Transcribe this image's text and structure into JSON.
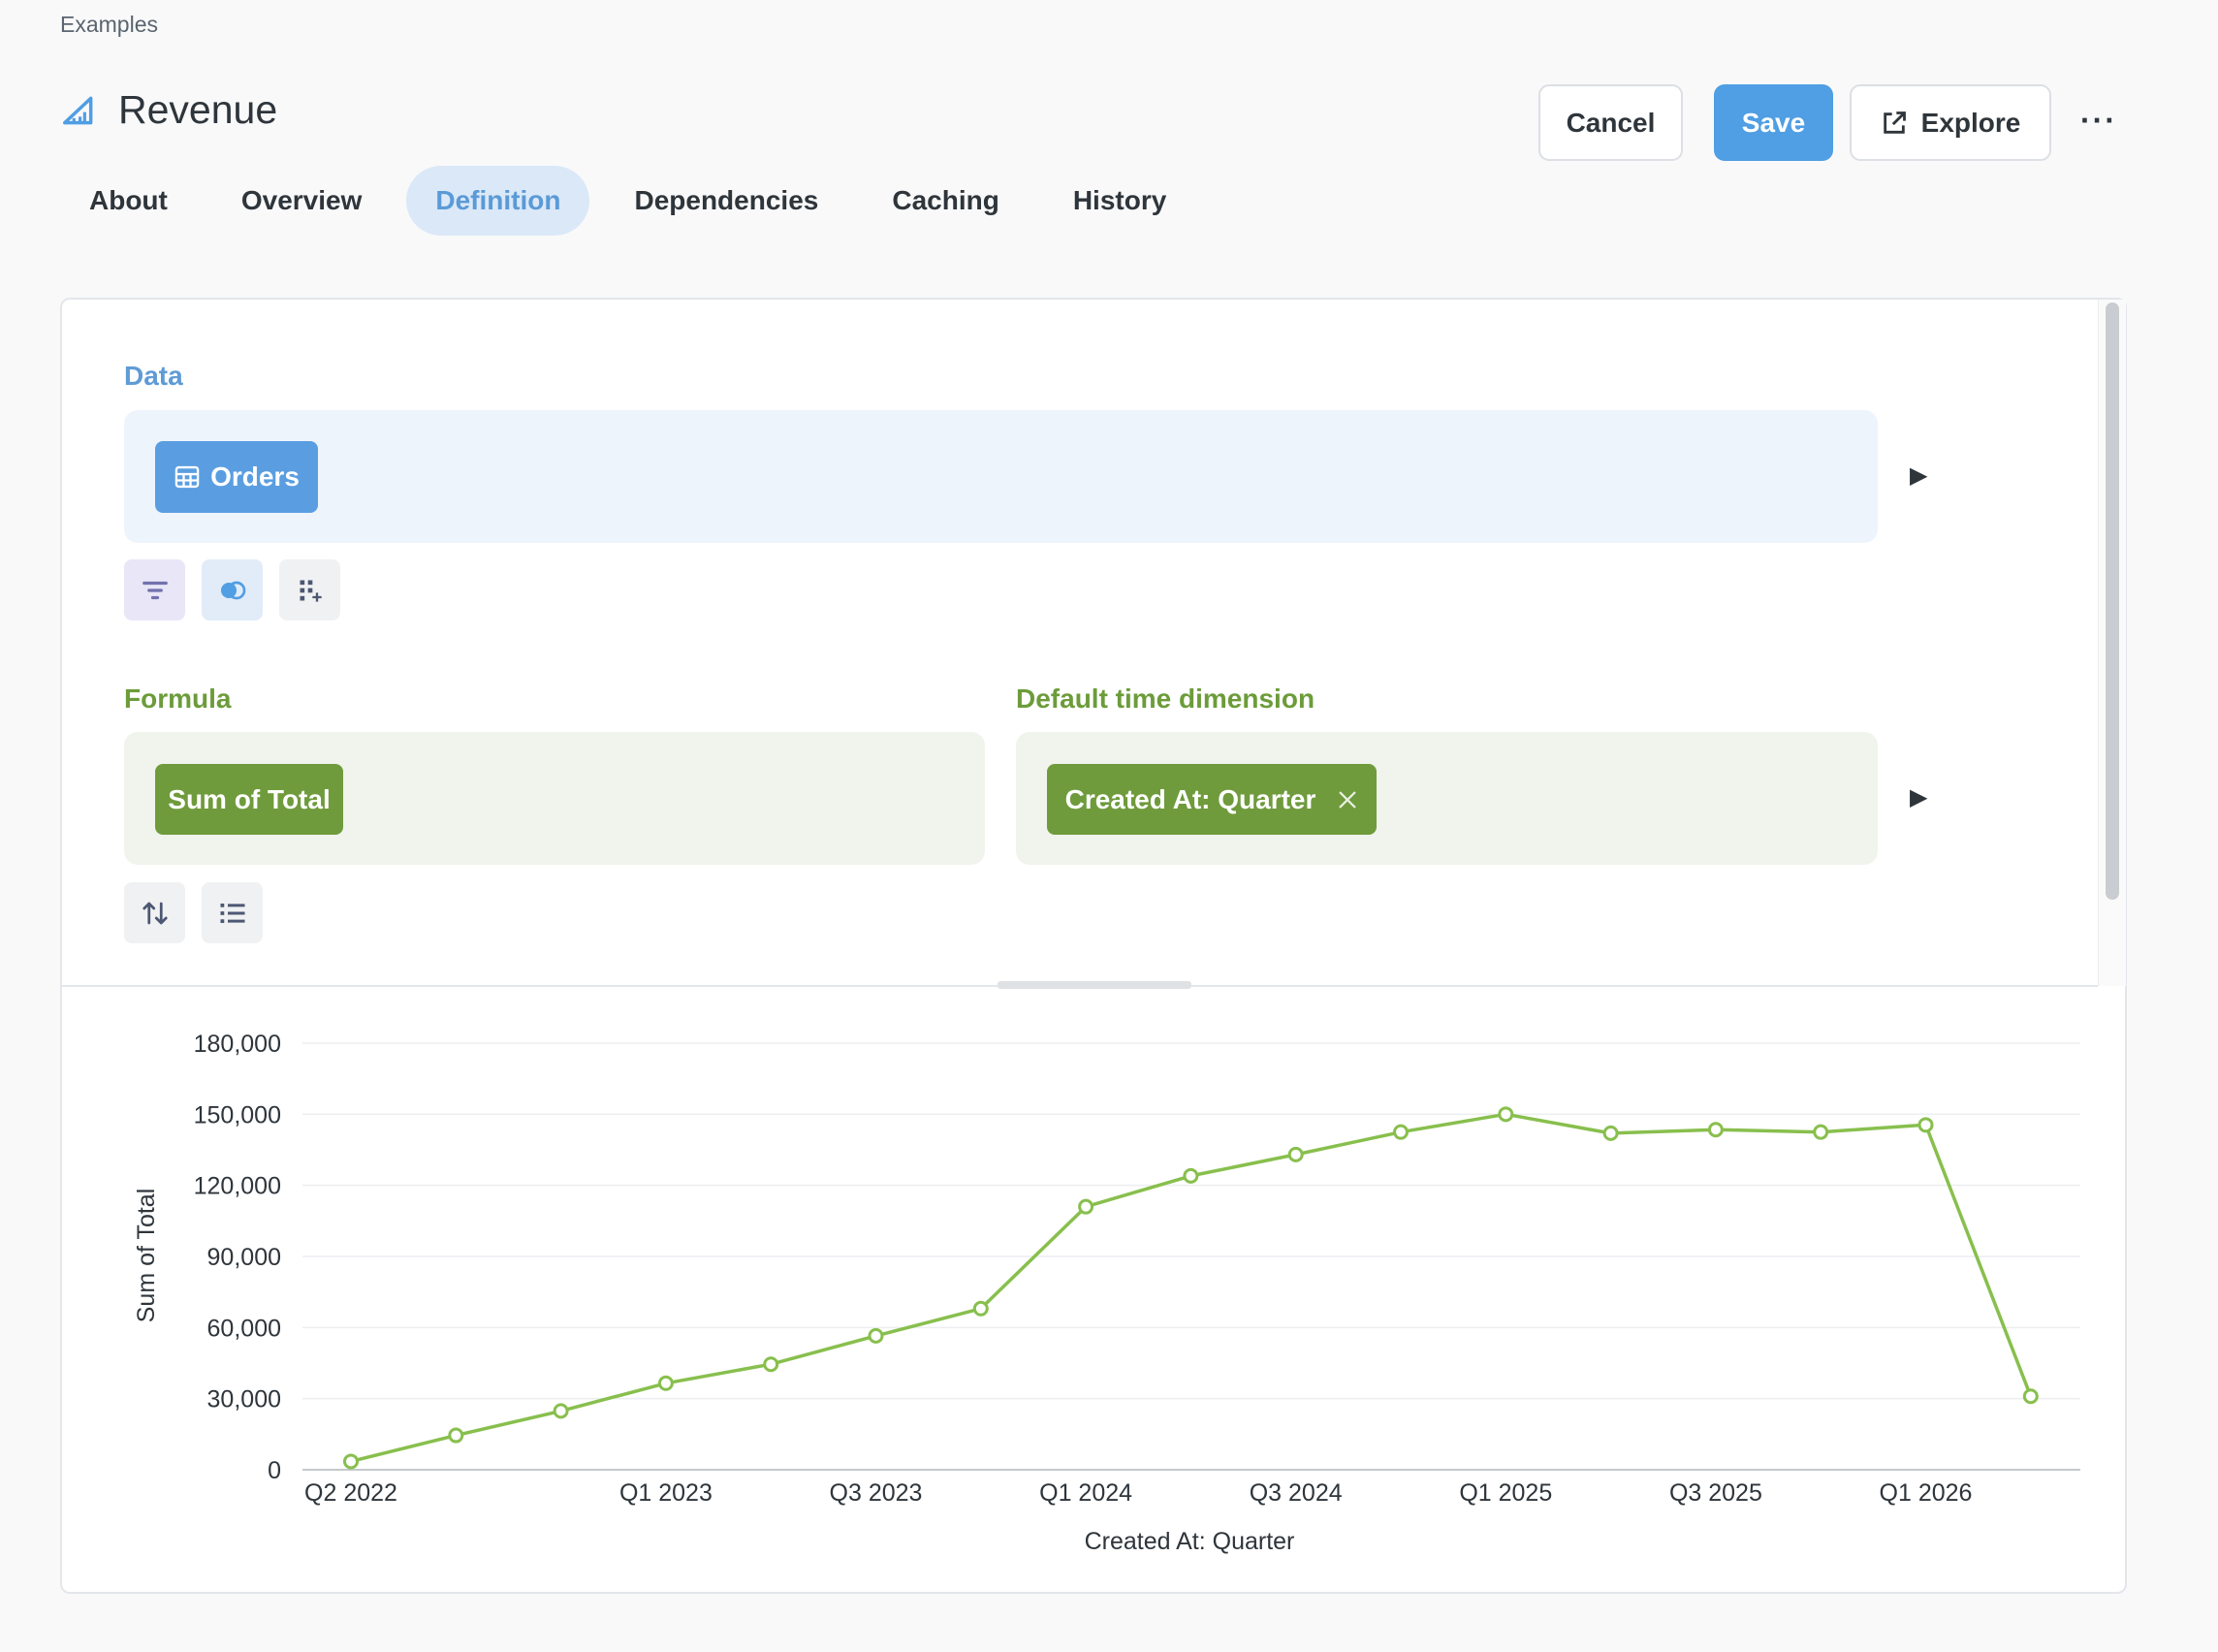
{
  "breadcrumb": "Examples",
  "page": {
    "title": "Revenue"
  },
  "tabs": [
    {
      "label": "About",
      "active": false
    },
    {
      "label": "Overview",
      "active": false
    },
    {
      "label": "Definition",
      "active": true
    },
    {
      "label": "Dependencies",
      "active": false
    },
    {
      "label": "Caching",
      "active": false
    },
    {
      "label": "History",
      "active": false
    }
  ],
  "actions": {
    "cancel": "Cancel",
    "save": "Save",
    "explore": "Explore",
    "more": "···"
  },
  "editor": {
    "data_label": "Data",
    "data_source": "Orders",
    "formula_label": "Formula",
    "formula_value": "Sum of Total",
    "time_label": "Default time dimension",
    "time_value": "Created At: Quarter"
  },
  "icons": {
    "metric": "metric-icon",
    "table": "table-icon",
    "filter": "filter-icon",
    "join": "join-icon",
    "custom_column": "custom-column-icon",
    "sort": "sort-icon",
    "limit": "list-icon",
    "explore": "external-link-icon",
    "remove": "close-icon",
    "run": "play-icon"
  },
  "colors": {
    "accent_blue": "#509ee3",
    "metric_green": "#6f9b3c",
    "line_green": "#88bf4d"
  },
  "chart_data": {
    "type": "line",
    "xlabel": "Created At: Quarter",
    "ylabel": "Sum of Total",
    "ylim": [
      0,
      180000
    ],
    "yticks": [
      "0",
      "30,000",
      "60,000",
      "90,000",
      "120,000",
      "150,000",
      "180,000"
    ],
    "xticks": [
      "Q2 2022",
      "Q1 2023",
      "Q3 2023",
      "Q1 2024",
      "Q3 2024",
      "Q1 2025",
      "Q3 2025",
      "Q1 2026"
    ],
    "x": [
      "Q2 2022",
      "Q3 2022",
      "Q4 2022",
      "Q1 2023",
      "Q2 2023",
      "Q3 2023",
      "Q4 2023",
      "Q1 2024",
      "Q2 2024",
      "Q3 2024",
      "Q4 2024",
      "Q1 2025",
      "Q2 2025",
      "Q3 2025",
      "Q4 2025",
      "Q1 2026",
      "Q2 2026"
    ],
    "values": [
      3500,
      14500,
      24800,
      36500,
      44500,
      56500,
      68000,
      111000,
      124000,
      133000,
      142500,
      150000,
      142000,
      143500,
      142500,
      145500,
      31000
    ],
    "grid": true,
    "legend": "none"
  }
}
